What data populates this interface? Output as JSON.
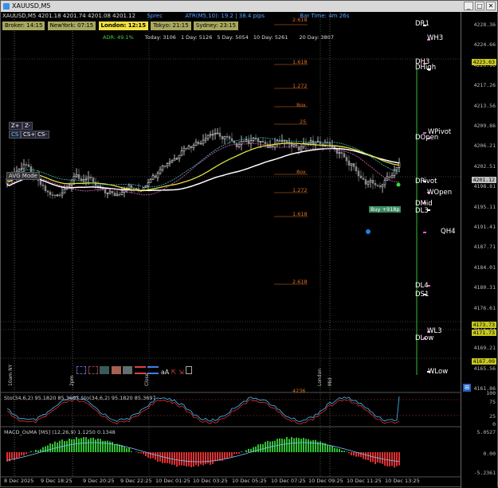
{
  "window": {
    "title": "XAUUSD,M5",
    "buttons": [
      "_",
      "□",
      "✕"
    ]
  },
  "header": {
    "quote": "XAUUSD,M5  4201.18 4201.74 4201.08 4201.12",
    "spread": "Sprec",
    "atr": "ATR(M5,10): 19.2  |  38.4 pips",
    "bar_time": "Bar Time: 4m 26s"
  },
  "sessions": [
    {
      "label": "Broker: 14:15",
      "color": "#b0b060"
    },
    {
      "label": "NewYork: 07:15",
      "color": "#b0b060"
    },
    {
      "label": "London: 12:15",
      "color": "#f0e040"
    },
    {
      "label": "Tokyo: 21:15",
      "color": "#b0b060"
    },
    {
      "label": "Sydney: 23:15",
      "color": "#b0b060"
    }
  ],
  "adr_line": {
    "adr": "ADR: 49.1%",
    "today": "Today: 3106",
    "day1": "1 Day: 5126",
    "day5": "5 Day: 5054",
    "day10": "10 Day: 5261",
    "day20": "20 Day: 3807"
  },
  "side_buttons": {
    "z_plus": "Z+",
    "z_minus": "Z-",
    "cs": "CS",
    "cs_plus": "CS+",
    "cs_minus": "CS-",
    "avg_mode": "AVG Mode"
  },
  "price_ticks": [
    "4228.36",
    "4224.66",
    "4220.96",
    "4217.26",
    "4213.56",
    "4209.86",
    "4206.21",
    "4202.51",
    "4198.81",
    "4195.11",
    "4191.41",
    "4187.71",
    "4184.01",
    "4180.31",
    "4176.61",
    "4172.91",
    "4169.21",
    "4165.56",
    "4161.86"
  ],
  "price_labels": [
    {
      "text": "4223.63",
      "color": "#c8c820"
    },
    {
      "text": "4201.12",
      "color": "#c0c0c0"
    },
    {
      "text": "4173.73",
      "color": "#c8c820"
    },
    {
      "text": "4171.73",
      "color": "#c8c820"
    },
    {
      "text": "4167.09",
      "color": "#c8c820"
    }
  ],
  "levels": [
    "DR1",
    "WH3",
    "DHigh",
    "DH3",
    "WPivot",
    "DOpen",
    "DPivot",
    "WOpen",
    "DMid",
    "DL3",
    "QH4",
    "DL4",
    "DS1",
    "WL3",
    "DLow",
    "WLow"
  ],
  "fib_levels": [
    "2.618",
    "1.618",
    "1.272",
    "8ox",
    "25",
    "8ox",
    "1.272",
    "1.618",
    "2.618",
    "4236"
  ],
  "trade_label": "Buy +918p",
  "time_labels": [
    "8 Dec 2025",
    "9 Dec 18:25",
    "9 Dec 20:25",
    "9 Dec 22:25",
    "10 Dec 01:25",
    "10 Dec 03:25",
    "10 Dec 05:25",
    "10 Dec 07:25",
    "10 Dec 09:25",
    "10 Dec 11:25",
    "10 Dec 13:25"
  ],
  "session_markers": [
    "10am NY",
    "2pm",
    "Close",
    "London",
    "Mid"
  ],
  "stoch": {
    "header": "Sto(34,6,2) 95.1820 85.3697  Sto(34,6,2) 95.1820 85.3697",
    "ticks": [
      "100",
      "75",
      "25",
      "0"
    ]
  },
  "macd": {
    "header": "MACD_OsMA [MS] (12,26,9)  1.1250  0.1348",
    "ticks": [
      "5.0527",
      "0.00",
      "-5.2361"
    ]
  },
  "colors": {
    "up_candle": "#ffffff",
    "down_candle": "#888888",
    "ema_fast": "#e0e040",
    "ema_slow": "#ffffff",
    "teal": "#40c0c0",
    "pink": "#e060c0",
    "fib": "#e07020"
  }
}
